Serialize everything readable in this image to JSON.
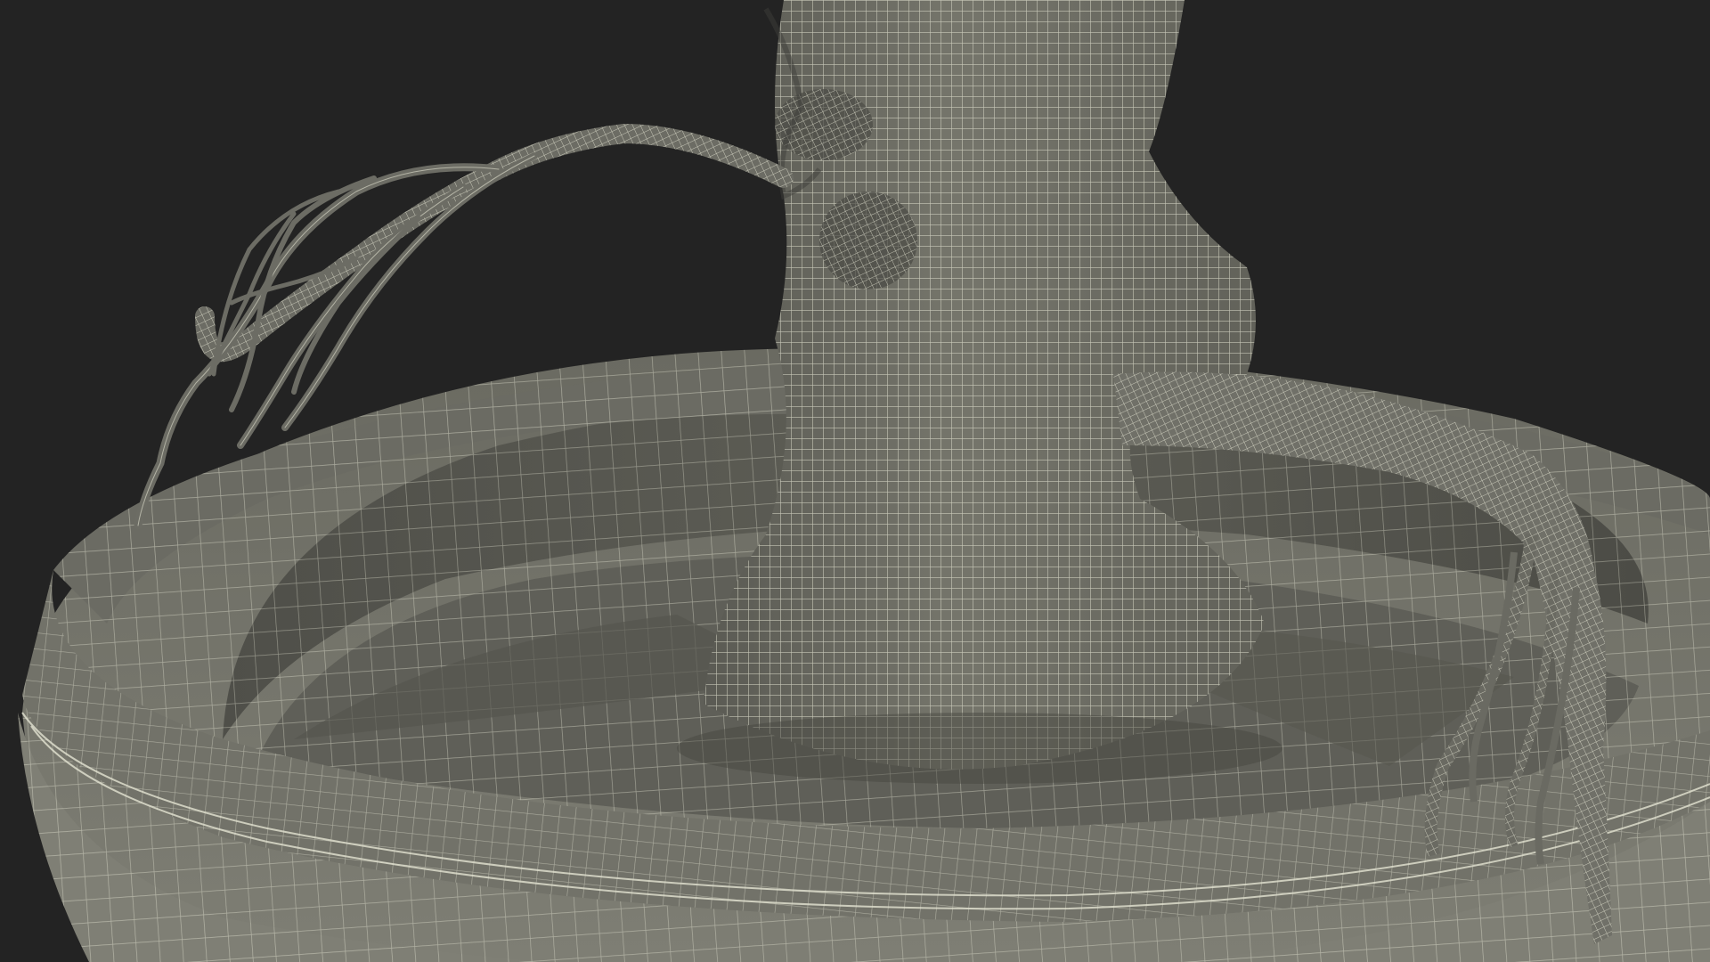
{
  "scene": {
    "subject": "wireframe-render",
    "colors": {
      "background": "#232323",
      "surface": "#6d6d64",
      "surface_light": "#7b7b71",
      "surface_dark": "#54544d",
      "shadow": "#45453f",
      "wire": "#e4e4d2"
    }
  }
}
